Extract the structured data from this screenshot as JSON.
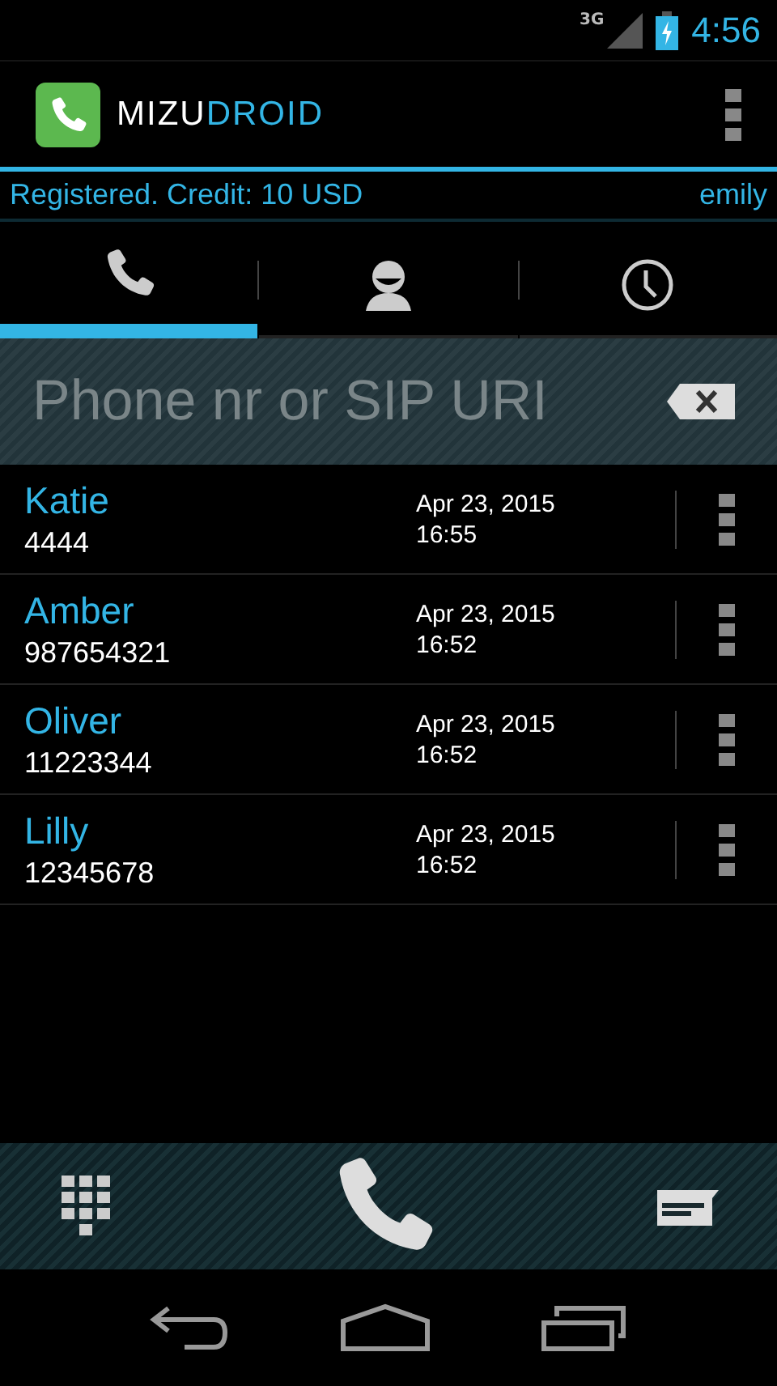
{
  "status_bar": {
    "network": "3G",
    "time": "4:56"
  },
  "app_bar": {
    "logo_first": "MIZU",
    "logo_second": "DROID"
  },
  "account": {
    "status": "Registered. Credit: 10 USD",
    "user": "emily"
  },
  "tabs": [
    {
      "kind": "phone",
      "selected": true
    },
    {
      "kind": "contacts",
      "selected": false
    },
    {
      "kind": "history",
      "selected": false
    }
  ],
  "dial_field": {
    "placeholder": "Phone nr or SIP URI"
  },
  "calls": [
    {
      "name": "Katie",
      "number": "4444",
      "date": "Apr 23, 2015",
      "time": "16:55"
    },
    {
      "name": "Amber",
      "number": "987654321",
      "date": "Apr 23, 2015",
      "time": "16:52"
    },
    {
      "name": "Oliver",
      "number": "11223344",
      "date": "Apr 23, 2015",
      "time": "16:52"
    },
    {
      "name": "Lilly",
      "number": "12345678",
      "date": "Apr 23, 2015",
      "time": "16:52"
    }
  ]
}
